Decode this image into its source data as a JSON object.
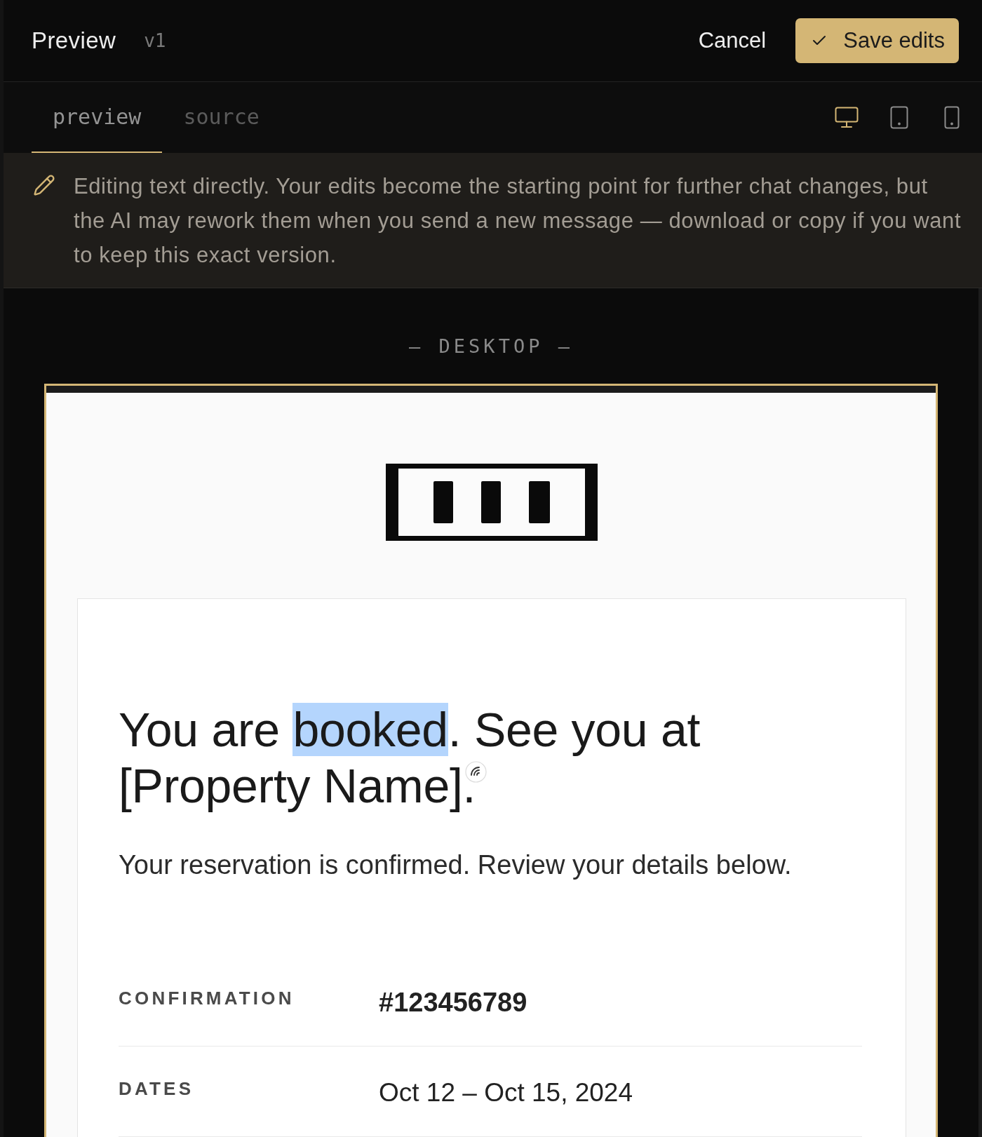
{
  "header": {
    "title": "Preview",
    "version": "v1",
    "cancel_button": "Cancel",
    "save_button": "Save edits"
  },
  "tabs": [
    {
      "label": "preview",
      "selected": true
    },
    {
      "label": "source",
      "selected": false
    }
  ],
  "devices": [
    {
      "kind": "desktop",
      "selected": true
    },
    {
      "kind": "tablet",
      "selected": false
    },
    {
      "kind": "phone",
      "selected": false
    }
  ],
  "notice": {
    "text": "Editing text directly. Your edits become the starting point for further chat changes, but the AI may rework them when you send a new message — download or copy if you want to keep this exact version."
  },
  "viewport_label": "— DESKTOP —",
  "email": {
    "headline": [
      {
        "text": "You are ",
        "selected": false
      },
      {
        "text": "booked",
        "selected": true
      },
      {
        "text": ". See you at [Property Name].",
        "selected": false
      }
    ],
    "subtitle": "Your reservation is confirmed. Review your details below.",
    "details": [
      {
        "label": "CONFIRMATION",
        "value": "#123456789",
        "emphasized": true
      },
      {
        "label": "DATES",
        "value": "Oct 12 – Oct 15, 2024",
        "emphasized": false
      }
    ]
  }
}
